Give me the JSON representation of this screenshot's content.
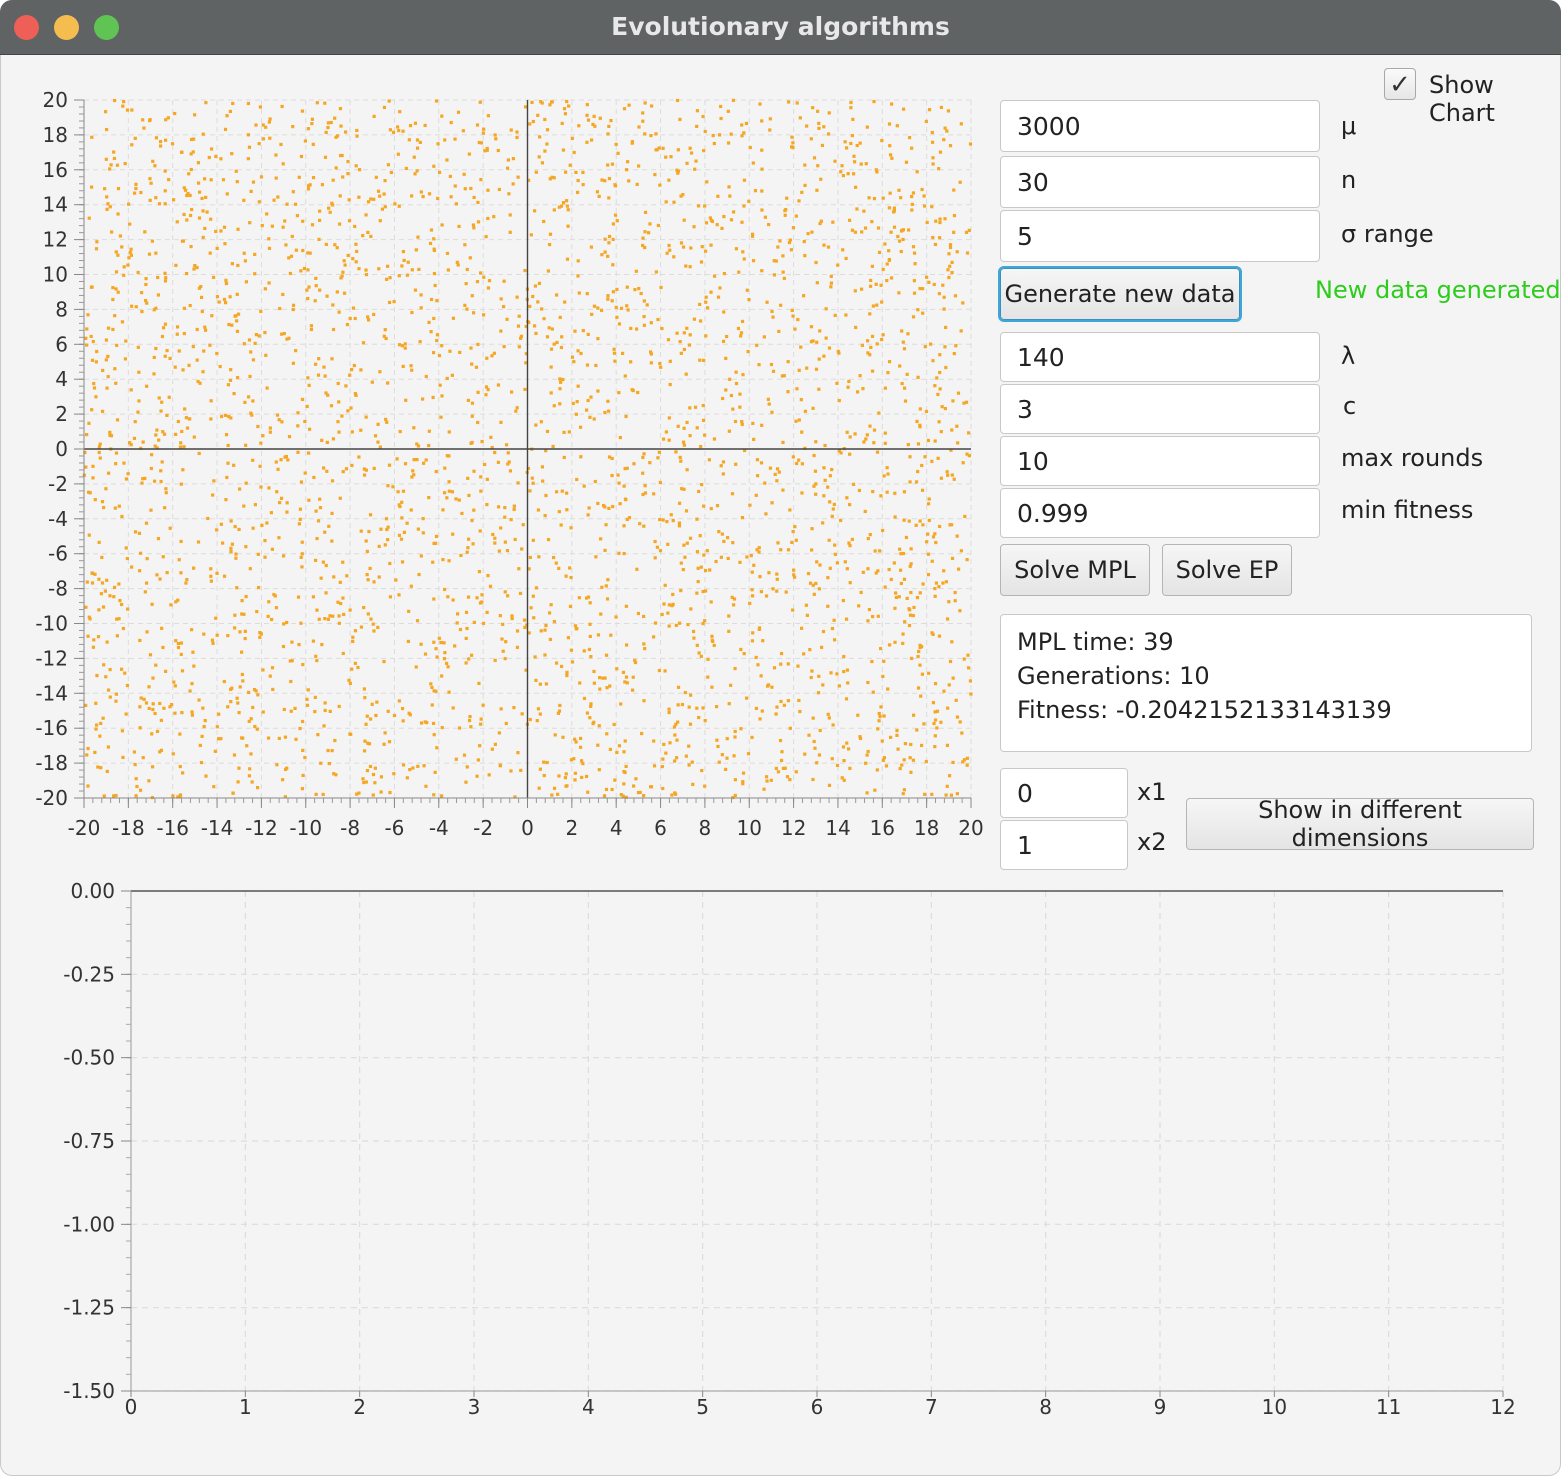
{
  "window": {
    "title": "Evolutionary algorithms",
    "buttons": [
      "close",
      "minimize",
      "maximize"
    ]
  },
  "controls": {
    "show_chart": {
      "label": "Show Chart",
      "checked": true
    },
    "mu": {
      "value": "3000",
      "label": "μ"
    },
    "n": {
      "value": "30",
      "label": "n"
    },
    "sigma_range": {
      "value": "5",
      "label": "σ range"
    },
    "generate_button": "Generate new data",
    "status_text": "New data generated",
    "lambda": {
      "value": "140",
      "label": "λ"
    },
    "c": {
      "value": "3",
      "label": "c"
    },
    "max_rounds": {
      "value": "10",
      "label": "max rounds"
    },
    "min_fitness": {
      "value": "0.999",
      "label": "min fitness"
    },
    "solve_mpl_button": "Solve MPL",
    "solve_ep_button": "Solve EP",
    "results": {
      "line1": "MPL time: 39",
      "line2": "Generations: 10",
      "line3": "Fitness: -0.2042152133143139"
    },
    "x1": {
      "value": "0",
      "label": "x1"
    },
    "x2": {
      "value": "1",
      "label": "x2"
    },
    "dimensions_button": "Show in different dimensions"
  },
  "colors": {
    "scatter_point": "#f5a623",
    "status_green": "#2ecc1c",
    "titlebar": "#5f6364"
  },
  "chart_data": [
    {
      "type": "scatter",
      "title": "",
      "xlabel": "",
      "ylabel": "",
      "xlim": [
        -20,
        20
      ],
      "ylim": [
        -20,
        20
      ],
      "x_ticks": [
        "-20",
        "-18",
        "-16",
        "-14",
        "-12",
        "-10",
        "-8",
        "-6",
        "-4",
        "-2",
        "0",
        "2",
        "4",
        "6",
        "8",
        "10",
        "12",
        "14",
        "16",
        "18",
        "20"
      ],
      "y_ticks": [
        "20",
        "18",
        "16",
        "14",
        "12",
        "10",
        "8",
        "6",
        "4",
        "2",
        "0",
        "-2",
        "-4",
        "-6",
        "-8",
        "-10",
        "-12",
        "-14",
        "-16",
        "-18",
        "-20"
      ],
      "point_count": 3000,
      "distribution": "uniform",
      "grid": true,
      "legend": "none"
    },
    {
      "type": "line",
      "title": "",
      "xlabel": "",
      "ylabel": "",
      "xlim": [
        0,
        12
      ],
      "ylim": [
        -1.5,
        0
      ],
      "x_ticks": [
        "0",
        "1",
        "2",
        "3",
        "4",
        "5",
        "6",
        "7",
        "8",
        "9",
        "10",
        "11",
        "12"
      ],
      "y_ticks": [
        "0.00",
        "-0.25",
        "-0.50",
        "-0.75",
        "-1.00",
        "-1.25",
        "-1.50"
      ],
      "series": [],
      "grid": true,
      "legend": "none"
    }
  ]
}
